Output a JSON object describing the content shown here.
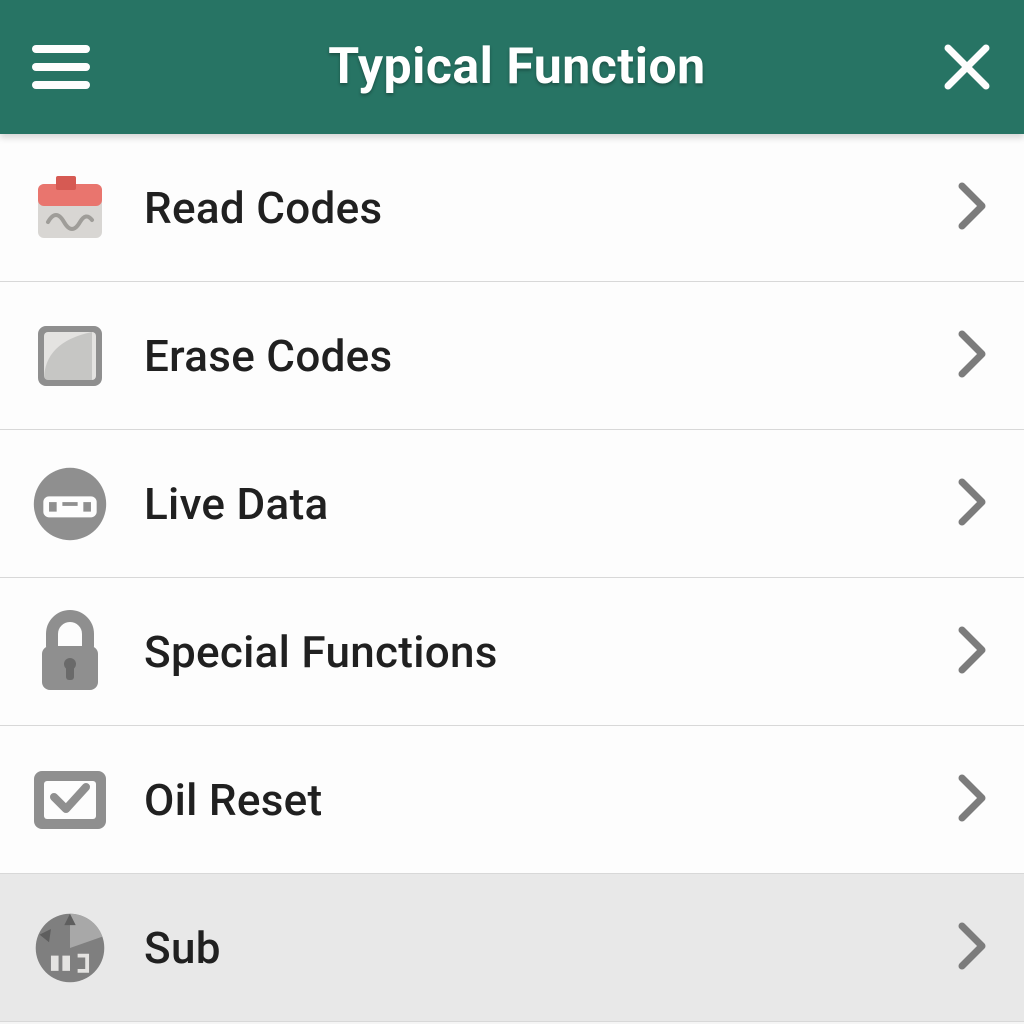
{
  "header": {
    "title": "Typical Function"
  },
  "items": [
    {
      "label": "Read Codes",
      "icon": "calendar-wave-icon",
      "highlight": false
    },
    {
      "label": "Erase Codes",
      "icon": "erase-icon",
      "highlight": false
    },
    {
      "label": "Live Data",
      "icon": "gauge-icon",
      "highlight": false
    },
    {
      "label": "Special Functions",
      "icon": "lock-icon",
      "highlight": false
    },
    {
      "label": "Oil Reset",
      "icon": "checkbox-icon",
      "highlight": false
    },
    {
      "label": "Sub",
      "icon": "pie-clock-icon",
      "highlight": true
    }
  ]
}
